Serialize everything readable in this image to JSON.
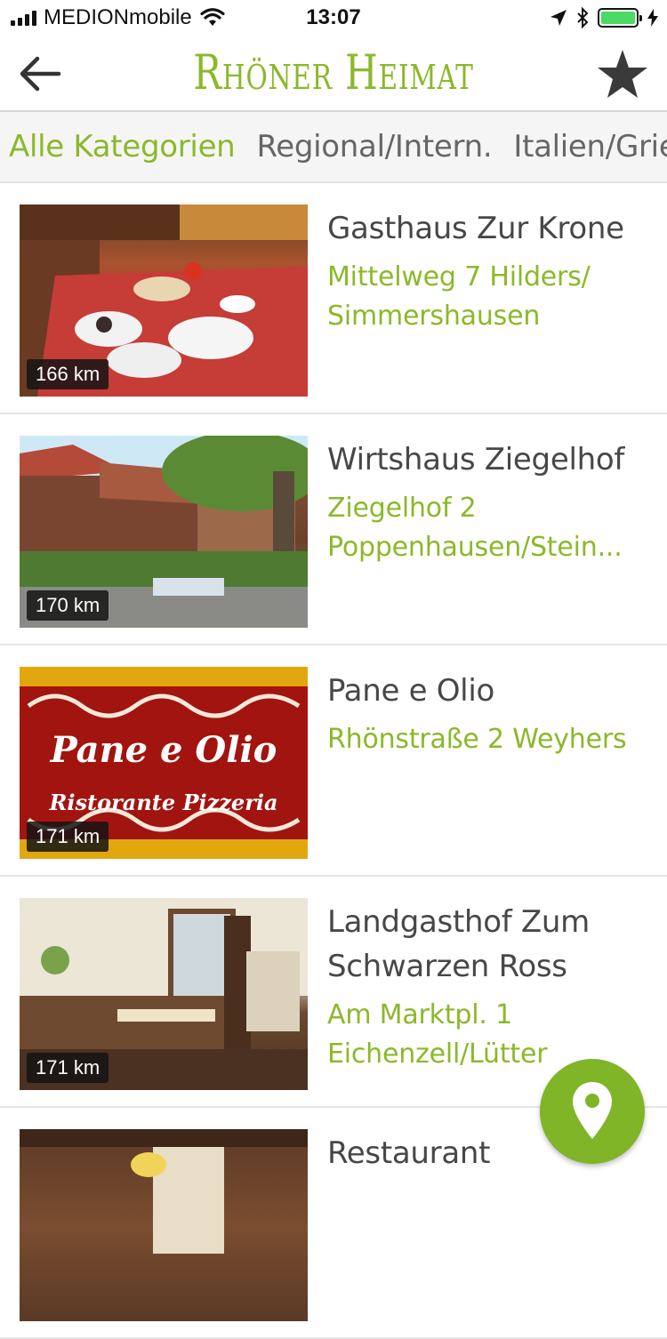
{
  "status_bar": {
    "carrier": "MEDIONmobile",
    "time": "13:07"
  },
  "header": {
    "title": "Rhöner Heimat"
  },
  "categories": [
    {
      "label": "Alle Kategorien",
      "active": true
    },
    {
      "label": "Regional/Intern.",
      "active": false
    },
    {
      "label": "Italien/Grie",
      "active": false
    }
  ],
  "restaurants": [
    {
      "name": "Gasthaus Zur Krone",
      "address": "Mittelweg 7 Hilders/ Simmershausen",
      "distance": "166 km"
    },
    {
      "name": "Wirtshaus Ziegelhof",
      "address": "Ziegelhof 2 Poppenhausen/Stein...",
      "distance": "170 km"
    },
    {
      "name": "Pane e Olio",
      "address": "Rhönstraße 2 Weyhers",
      "distance": "171 km",
      "logo_line1": "Pane e Olio",
      "logo_line2": "Ristorante Pizzeria"
    },
    {
      "name": "Landgasthof Zum Schwarzen Ross",
      "address": "Am Marktpl. 1 Eichenzell/Lütter",
      "distance": "171 km"
    },
    {
      "name": "Restaurant",
      "address": "",
      "distance": ""
    }
  ],
  "icons": {
    "back": "arrow-left-icon",
    "favorites": "star-icon",
    "map": "map-pin-icon"
  },
  "colors": {
    "accent": "#8cb82a",
    "fab": "#7fb527"
  }
}
